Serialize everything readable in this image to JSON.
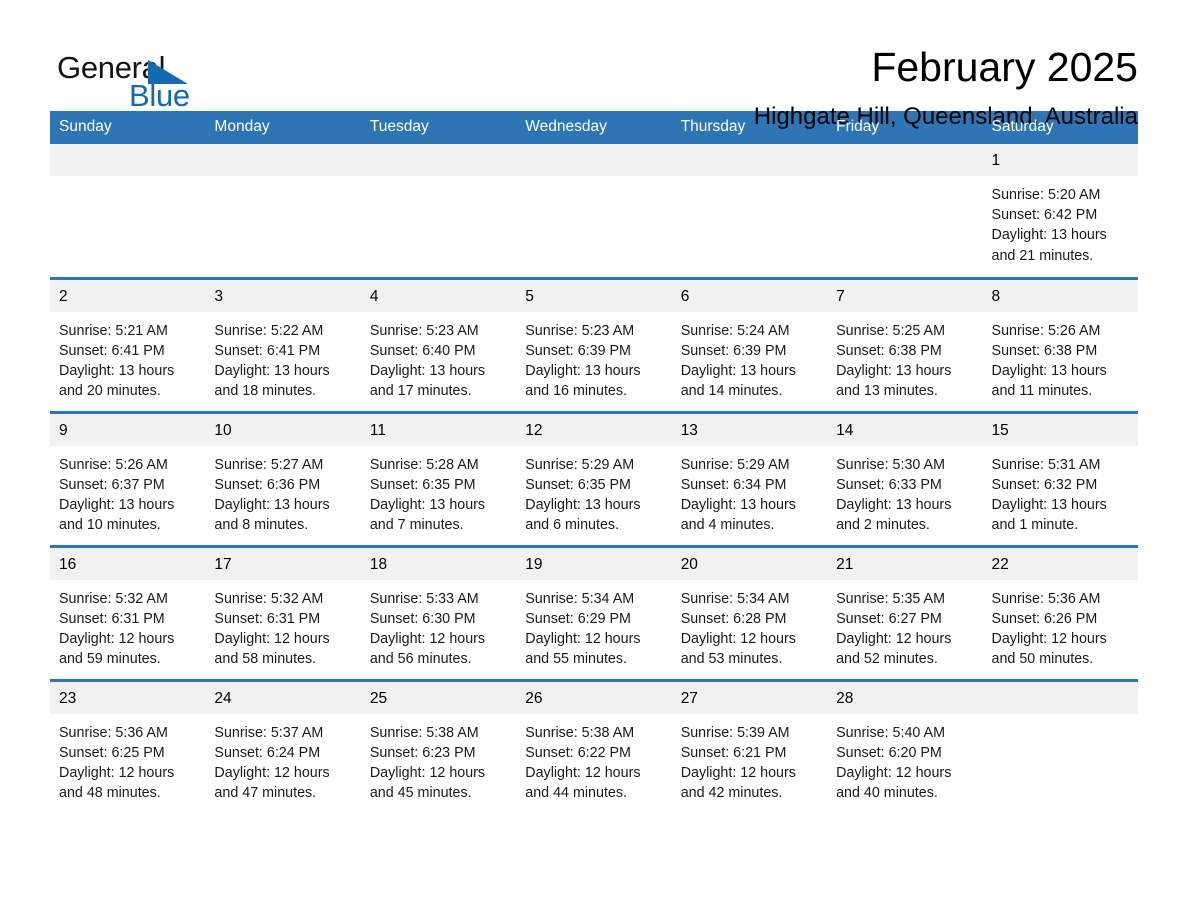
{
  "logo": {
    "word_one": "General",
    "word_two": "Blue",
    "accent_color": "#1569b0",
    "triangle_icon": "triangle-icon"
  },
  "header": {
    "title": "February 2025",
    "subtitle": "Highgate Hill, Queensland, Australia"
  },
  "theme": {
    "header_blue": "#2e75b6",
    "daynum_gray": "#f1f1f1",
    "text_black": "#000000"
  },
  "calendar": {
    "weekday_headers": [
      "Sunday",
      "Monday",
      "Tuesday",
      "Wednesday",
      "Thursday",
      "Friday",
      "Saturday"
    ],
    "labels": {
      "sunrise": "Sunrise:",
      "sunset": "Sunset:",
      "daylight": "Daylight:"
    },
    "weeks": [
      [
        {
          "day": "",
          "sunrise": "",
          "sunset": "",
          "daylight_line1": "",
          "daylight_line2": ""
        },
        {
          "day": "",
          "sunrise": "",
          "sunset": "",
          "daylight_line1": "",
          "daylight_line2": ""
        },
        {
          "day": "",
          "sunrise": "",
          "sunset": "",
          "daylight_line1": "",
          "daylight_line2": ""
        },
        {
          "day": "",
          "sunrise": "",
          "sunset": "",
          "daylight_line1": "",
          "daylight_line2": ""
        },
        {
          "day": "",
          "sunrise": "",
          "sunset": "",
          "daylight_line1": "",
          "daylight_line2": ""
        },
        {
          "day": "",
          "sunrise": "",
          "sunset": "",
          "daylight_line1": "",
          "daylight_line2": ""
        },
        {
          "day": "1",
          "sunrise": "Sunrise: 5:20 AM",
          "sunset": "Sunset: 6:42 PM",
          "daylight_line1": "Daylight: 13 hours",
          "daylight_line2": "and 21 minutes."
        }
      ],
      [
        {
          "day": "2",
          "sunrise": "Sunrise: 5:21 AM",
          "sunset": "Sunset: 6:41 PM",
          "daylight_line1": "Daylight: 13 hours",
          "daylight_line2": "and 20 minutes."
        },
        {
          "day": "3",
          "sunrise": "Sunrise: 5:22 AM",
          "sunset": "Sunset: 6:41 PM",
          "daylight_line1": "Daylight: 13 hours",
          "daylight_line2": "and 18 minutes."
        },
        {
          "day": "4",
          "sunrise": "Sunrise: 5:23 AM",
          "sunset": "Sunset: 6:40 PM",
          "daylight_line1": "Daylight: 13 hours",
          "daylight_line2": "and 17 minutes."
        },
        {
          "day": "5",
          "sunrise": "Sunrise: 5:23 AM",
          "sunset": "Sunset: 6:39 PM",
          "daylight_line1": "Daylight: 13 hours",
          "daylight_line2": "and 16 minutes."
        },
        {
          "day": "6",
          "sunrise": "Sunrise: 5:24 AM",
          "sunset": "Sunset: 6:39 PM",
          "daylight_line1": "Daylight: 13 hours",
          "daylight_line2": "and 14 minutes."
        },
        {
          "day": "7",
          "sunrise": "Sunrise: 5:25 AM",
          "sunset": "Sunset: 6:38 PM",
          "daylight_line1": "Daylight: 13 hours",
          "daylight_line2": "and 13 minutes."
        },
        {
          "day": "8",
          "sunrise": "Sunrise: 5:26 AM",
          "sunset": "Sunset: 6:38 PM",
          "daylight_line1": "Daylight: 13 hours",
          "daylight_line2": "and 11 minutes."
        }
      ],
      [
        {
          "day": "9",
          "sunrise": "Sunrise: 5:26 AM",
          "sunset": "Sunset: 6:37 PM",
          "daylight_line1": "Daylight: 13 hours",
          "daylight_line2": "and 10 minutes."
        },
        {
          "day": "10",
          "sunrise": "Sunrise: 5:27 AM",
          "sunset": "Sunset: 6:36 PM",
          "daylight_line1": "Daylight: 13 hours",
          "daylight_line2": "and 8 minutes."
        },
        {
          "day": "11",
          "sunrise": "Sunrise: 5:28 AM",
          "sunset": "Sunset: 6:35 PM",
          "daylight_line1": "Daylight: 13 hours",
          "daylight_line2": "and 7 minutes."
        },
        {
          "day": "12",
          "sunrise": "Sunrise: 5:29 AM",
          "sunset": "Sunset: 6:35 PM",
          "daylight_line1": "Daylight: 13 hours",
          "daylight_line2": "and 6 minutes."
        },
        {
          "day": "13",
          "sunrise": "Sunrise: 5:29 AM",
          "sunset": "Sunset: 6:34 PM",
          "daylight_line1": "Daylight: 13 hours",
          "daylight_line2": "and 4 minutes."
        },
        {
          "day": "14",
          "sunrise": "Sunrise: 5:30 AM",
          "sunset": "Sunset: 6:33 PM",
          "daylight_line1": "Daylight: 13 hours",
          "daylight_line2": "and 2 minutes."
        },
        {
          "day": "15",
          "sunrise": "Sunrise: 5:31 AM",
          "sunset": "Sunset: 6:32 PM",
          "daylight_line1": "Daylight: 13 hours",
          "daylight_line2": "and 1 minute."
        }
      ],
      [
        {
          "day": "16",
          "sunrise": "Sunrise: 5:32 AM",
          "sunset": "Sunset: 6:31 PM",
          "daylight_line1": "Daylight: 12 hours",
          "daylight_line2": "and 59 minutes."
        },
        {
          "day": "17",
          "sunrise": "Sunrise: 5:32 AM",
          "sunset": "Sunset: 6:31 PM",
          "daylight_line1": "Daylight: 12 hours",
          "daylight_line2": "and 58 minutes."
        },
        {
          "day": "18",
          "sunrise": "Sunrise: 5:33 AM",
          "sunset": "Sunset: 6:30 PM",
          "daylight_line1": "Daylight: 12 hours",
          "daylight_line2": "and 56 minutes."
        },
        {
          "day": "19",
          "sunrise": "Sunrise: 5:34 AM",
          "sunset": "Sunset: 6:29 PM",
          "daylight_line1": "Daylight: 12 hours",
          "daylight_line2": "and 55 minutes."
        },
        {
          "day": "20",
          "sunrise": "Sunrise: 5:34 AM",
          "sunset": "Sunset: 6:28 PM",
          "daylight_line1": "Daylight: 12 hours",
          "daylight_line2": "and 53 minutes."
        },
        {
          "day": "21",
          "sunrise": "Sunrise: 5:35 AM",
          "sunset": "Sunset: 6:27 PM",
          "daylight_line1": "Daylight: 12 hours",
          "daylight_line2": "and 52 minutes."
        },
        {
          "day": "22",
          "sunrise": "Sunrise: 5:36 AM",
          "sunset": "Sunset: 6:26 PM",
          "daylight_line1": "Daylight: 12 hours",
          "daylight_line2": "and 50 minutes."
        }
      ],
      [
        {
          "day": "23",
          "sunrise": "Sunrise: 5:36 AM",
          "sunset": "Sunset: 6:25 PM",
          "daylight_line1": "Daylight: 12 hours",
          "daylight_line2": "and 48 minutes."
        },
        {
          "day": "24",
          "sunrise": "Sunrise: 5:37 AM",
          "sunset": "Sunset: 6:24 PM",
          "daylight_line1": "Daylight: 12 hours",
          "daylight_line2": "and 47 minutes."
        },
        {
          "day": "25",
          "sunrise": "Sunrise: 5:38 AM",
          "sunset": "Sunset: 6:23 PM",
          "daylight_line1": "Daylight: 12 hours",
          "daylight_line2": "and 45 minutes."
        },
        {
          "day": "26",
          "sunrise": "Sunrise: 5:38 AM",
          "sunset": "Sunset: 6:22 PM",
          "daylight_line1": "Daylight: 12 hours",
          "daylight_line2": "and 44 minutes."
        },
        {
          "day": "27",
          "sunrise": "Sunrise: 5:39 AM",
          "sunset": "Sunset: 6:21 PM",
          "daylight_line1": "Daylight: 12 hours",
          "daylight_line2": "and 42 minutes."
        },
        {
          "day": "28",
          "sunrise": "Sunrise: 5:40 AM",
          "sunset": "Sunset: 6:20 PM",
          "daylight_line1": "Daylight: 12 hours",
          "daylight_line2": "and 40 minutes."
        },
        {
          "day": "",
          "sunrise": "",
          "sunset": "",
          "daylight_line1": "",
          "daylight_line2": ""
        }
      ]
    ]
  }
}
